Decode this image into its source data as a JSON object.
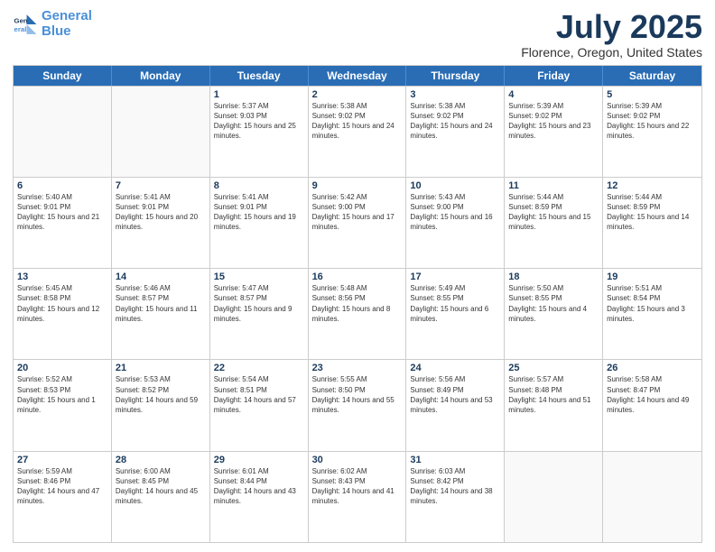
{
  "logo": {
    "line1": "General",
    "line2": "Blue"
  },
  "title": "July 2025",
  "subtitle": "Florence, Oregon, United States",
  "days_of_week": [
    "Sunday",
    "Monday",
    "Tuesday",
    "Wednesday",
    "Thursday",
    "Friday",
    "Saturday"
  ],
  "weeks": [
    [
      {
        "day": "",
        "info": ""
      },
      {
        "day": "",
        "info": ""
      },
      {
        "day": "1",
        "info": "Sunrise: 5:37 AM\nSunset: 9:03 PM\nDaylight: 15 hours and 25 minutes."
      },
      {
        "day": "2",
        "info": "Sunrise: 5:38 AM\nSunset: 9:02 PM\nDaylight: 15 hours and 24 minutes."
      },
      {
        "day": "3",
        "info": "Sunrise: 5:38 AM\nSunset: 9:02 PM\nDaylight: 15 hours and 24 minutes."
      },
      {
        "day": "4",
        "info": "Sunrise: 5:39 AM\nSunset: 9:02 PM\nDaylight: 15 hours and 23 minutes."
      },
      {
        "day": "5",
        "info": "Sunrise: 5:39 AM\nSunset: 9:02 PM\nDaylight: 15 hours and 22 minutes."
      }
    ],
    [
      {
        "day": "6",
        "info": "Sunrise: 5:40 AM\nSunset: 9:01 PM\nDaylight: 15 hours and 21 minutes."
      },
      {
        "day": "7",
        "info": "Sunrise: 5:41 AM\nSunset: 9:01 PM\nDaylight: 15 hours and 20 minutes."
      },
      {
        "day": "8",
        "info": "Sunrise: 5:41 AM\nSunset: 9:01 PM\nDaylight: 15 hours and 19 minutes."
      },
      {
        "day": "9",
        "info": "Sunrise: 5:42 AM\nSunset: 9:00 PM\nDaylight: 15 hours and 17 minutes."
      },
      {
        "day": "10",
        "info": "Sunrise: 5:43 AM\nSunset: 9:00 PM\nDaylight: 15 hours and 16 minutes."
      },
      {
        "day": "11",
        "info": "Sunrise: 5:44 AM\nSunset: 8:59 PM\nDaylight: 15 hours and 15 minutes."
      },
      {
        "day": "12",
        "info": "Sunrise: 5:44 AM\nSunset: 8:59 PM\nDaylight: 15 hours and 14 minutes."
      }
    ],
    [
      {
        "day": "13",
        "info": "Sunrise: 5:45 AM\nSunset: 8:58 PM\nDaylight: 15 hours and 12 minutes."
      },
      {
        "day": "14",
        "info": "Sunrise: 5:46 AM\nSunset: 8:57 PM\nDaylight: 15 hours and 11 minutes."
      },
      {
        "day": "15",
        "info": "Sunrise: 5:47 AM\nSunset: 8:57 PM\nDaylight: 15 hours and 9 minutes."
      },
      {
        "day": "16",
        "info": "Sunrise: 5:48 AM\nSunset: 8:56 PM\nDaylight: 15 hours and 8 minutes."
      },
      {
        "day": "17",
        "info": "Sunrise: 5:49 AM\nSunset: 8:55 PM\nDaylight: 15 hours and 6 minutes."
      },
      {
        "day": "18",
        "info": "Sunrise: 5:50 AM\nSunset: 8:55 PM\nDaylight: 15 hours and 4 minutes."
      },
      {
        "day": "19",
        "info": "Sunrise: 5:51 AM\nSunset: 8:54 PM\nDaylight: 15 hours and 3 minutes."
      }
    ],
    [
      {
        "day": "20",
        "info": "Sunrise: 5:52 AM\nSunset: 8:53 PM\nDaylight: 15 hours and 1 minute."
      },
      {
        "day": "21",
        "info": "Sunrise: 5:53 AM\nSunset: 8:52 PM\nDaylight: 14 hours and 59 minutes."
      },
      {
        "day": "22",
        "info": "Sunrise: 5:54 AM\nSunset: 8:51 PM\nDaylight: 14 hours and 57 minutes."
      },
      {
        "day": "23",
        "info": "Sunrise: 5:55 AM\nSunset: 8:50 PM\nDaylight: 14 hours and 55 minutes."
      },
      {
        "day": "24",
        "info": "Sunrise: 5:56 AM\nSunset: 8:49 PM\nDaylight: 14 hours and 53 minutes."
      },
      {
        "day": "25",
        "info": "Sunrise: 5:57 AM\nSunset: 8:48 PM\nDaylight: 14 hours and 51 minutes."
      },
      {
        "day": "26",
        "info": "Sunrise: 5:58 AM\nSunset: 8:47 PM\nDaylight: 14 hours and 49 minutes."
      }
    ],
    [
      {
        "day": "27",
        "info": "Sunrise: 5:59 AM\nSunset: 8:46 PM\nDaylight: 14 hours and 47 minutes."
      },
      {
        "day": "28",
        "info": "Sunrise: 6:00 AM\nSunset: 8:45 PM\nDaylight: 14 hours and 45 minutes."
      },
      {
        "day": "29",
        "info": "Sunrise: 6:01 AM\nSunset: 8:44 PM\nDaylight: 14 hours and 43 minutes."
      },
      {
        "day": "30",
        "info": "Sunrise: 6:02 AM\nSunset: 8:43 PM\nDaylight: 14 hours and 41 minutes."
      },
      {
        "day": "31",
        "info": "Sunrise: 6:03 AM\nSunset: 8:42 PM\nDaylight: 14 hours and 38 minutes."
      },
      {
        "day": "",
        "info": ""
      },
      {
        "day": "",
        "info": ""
      }
    ]
  ]
}
